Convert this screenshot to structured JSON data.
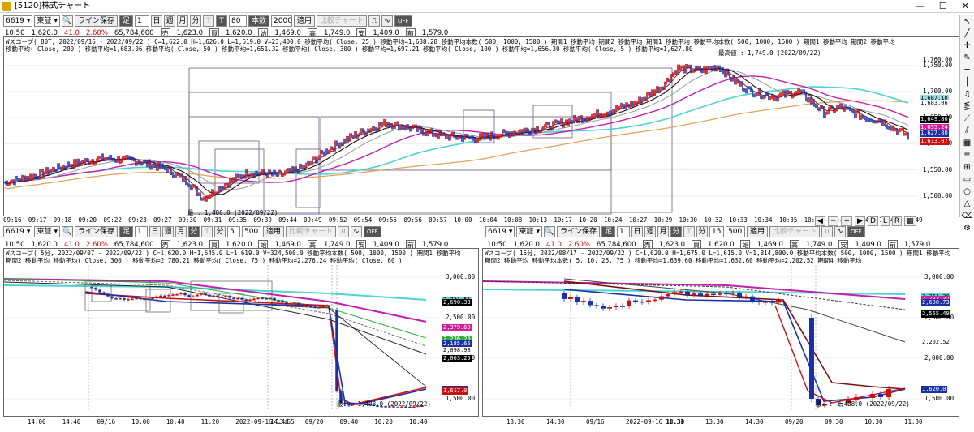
{
  "window": {
    "title": "[5120]株式チャート",
    "controls": [
      "—",
      "☐",
      "✕"
    ]
  },
  "toolbar_top": {
    "code": "6619",
    "market": "東証",
    "line_save": "ライン保存",
    "ashi": "足",
    "ashi_num": "1",
    "day": "日",
    "week": "週",
    "month": "月",
    "minute": "分",
    "t1": "T",
    "t2": "T",
    "bars_value": "80",
    "honsu": "本数",
    "count": "2000",
    "apply": "適用",
    "compare": "比較チャート",
    "off": "OFF"
  },
  "toolbar_left": {
    "code": "6619",
    "market": "東証",
    "line_save": "ライン保存",
    "ashi": "足",
    "ashi_num": "1",
    "day": "日",
    "week": "週",
    "month": "月",
    "minute": "分",
    "t1": "T",
    "minute2": "分",
    "value": "5",
    "count": "500",
    "apply": "適用",
    "compare": "比較チャート",
    "off": "OFF"
  },
  "toolbar_right": {
    "code": "6619",
    "market": "東証",
    "line_save": "ライン保存",
    "ashi": "足",
    "ashi_num": "1",
    "day": "日",
    "week": "週",
    "month": "月",
    "minute": "分",
    "t1": "T",
    "minute2": "分",
    "value": "15",
    "count": "500",
    "apply": "適用",
    "compare": "比較チャート",
    "off": "OFF"
  },
  "quote": {
    "time": "10:50",
    "price": "1,620.0",
    "change": "41.0",
    "pct": "2.60%",
    "volume": "65,784,600",
    "sell_lab": "売",
    "sell": "1,623.0",
    "buy_lab": "買",
    "buy": "1,620.0",
    "start_lab": "始",
    "open": "1,469.0",
    "high_lab": "高",
    "high": "1,749.0",
    "low_lab": "安",
    "prev": "1,409.0",
    "prev_lab": "前",
    "last": "1,579.0"
  },
  "top_chart": {
    "header1": "Wスコープ( 80T, 2022/09/16 - 2022/09/22 ) C=1,622.0 H=1,626.0 L=1,619.0 V=23,400.0   移動平均( Close, 25 ) 移動平均=1,638.28  移動平均本数( 500, 1000, 1500 ) 期間1 移動平均 期間2 移動平均 期間1 移動平均 移動平均本数( 500, 1000, 1500 ) 期間1 移動平均 期間2 移動平均",
    "header2": "移動平均( Close, 200 ) 移動平均=1,683.06   移動平均( Close, 50 ) 移動平均=1,651.32   移動平均( Close, 300 ) 移動平均=1,697.21   移動平均( Close, 100 ) 移動平均=1,656.30   移動平均( Close, 5 ) 移動平均=1,627.80",
    "max_label": "最高値 : 1,749.0 (2022/09/22)",
    "min_label": "最 : 1,480.0 (2022/09/22)",
    "y_ticks": [
      "1,760.00",
      "1,750.00",
      "1,700.00",
      "1,650.00",
      "1,600.00",
      "1,550.00",
      "1,500.00"
    ],
    "price_labels": [
      {
        "text": "1,687.10",
        "bg": "#9ad8e0",
        "fg": "#000"
      },
      {
        "text": "1,683.06",
        "bg": "#ffffff",
        "fg": "#000"
      },
      {
        "text": "1,649.80",
        "bg": "#000000",
        "fg": "#fff"
      },
      {
        "text": "1,635.24",
        "bg": "#d01f9a",
        "fg": "#fff"
      },
      {
        "text": "1,627.80",
        "bg": "#1b2fa6",
        "fg": "#fff"
      },
      {
        "text": "1,613.07",
        "bg": "#cc1010",
        "fg": "#fff"
      }
    ],
    "x_ticks": [
      "09:16",
      "09:17",
      "09:18",
      "09:20",
      "09:22",
      "09:23",
      "09:27",
      "09:30",
      "09:31",
      "09:35",
      "09:39",
      "09:44",
      "09:49",
      "09:52",
      "09:54",
      "09:55",
      "09:56",
      "09:57",
      "10:00",
      "10:04",
      "10:08",
      "10:13",
      "10:17",
      "10:20",
      "10:24",
      "10:27",
      "10:29",
      "10:30",
      "10:32",
      "10:33",
      "10:34",
      "10:35",
      "10:38",
      "10:41",
      "10:42",
      "10:44",
      "10:49"
    ]
  },
  "left_chart": {
    "header1": "Wスコープ( 5分, 2022/09/07 - 2022/09/22 ) C=1,620.0 H=1,645.0 L=1,619.0 V=324,500.0  移動平均本数( 500, 1000, 1500 ) 期間1 移動平均",
    "header2": "期間2 移動平均 移動平均( Close, 300 ) 移動平均=2,780.21  移動平均( Close, 75 ) 移動平均=2,276.24   移動平均( Close, 60 )",
    "y_ticks": [
      "3,000.00",
      "2,500.00",
      "2,000.00",
      "1,500.00"
    ],
    "min_label": "最↓ : 1,408.0 (2022/09/22)",
    "price_labels": [
      {
        "text": "2,721.51",
        "bg": "#5fd0d6",
        "fg": "#000"
      },
      {
        "text": "2,690.33",
        "bg": "#000000",
        "fg": "#fff"
      },
      {
        "text": "2,379.69",
        "bg": "#d01f9a",
        "fg": "#fff"
      },
      {
        "text": "2,236.20",
        "bg": "#2fae3d",
        "fg": "#fff"
      },
      {
        "text": "2,185.65",
        "bg": "#1b2fa6",
        "fg": "#fff"
      },
      {
        "text": "2,098.98",
        "bg": "#ffffff",
        "fg": "#000"
      },
      {
        "text": "2,003.25",
        "bg": "#000000",
        "fg": "#fff"
      },
      {
        "text": "1,617.0",
        "bg": "#1b2fa6",
        "fg": "#fff"
      },
      {
        "text": "1,617.0",
        "bg": "#cc1010",
        "fg": "#fff"
      }
    ],
    "x_ticks": [
      "14:00",
      "14:40",
      "09/16",
      "10:00",
      "10:40",
      "11:20",
      "2022-09-16 13:55",
      "14:40",
      "09/20",
      "09:40",
      "10:20",
      "10:40"
    ]
  },
  "right_chart": {
    "header1": "Wスコープ( 15分, 2022/08/17 - 2022/09/22 ) C=1,620.0 H=1,675.0 L=1,615.0 V=1,814,800.0  移動平均本数( 500, 1000, 1500 ) 期間1 移動平均",
    "header2": "期間2 移動平均 移動平均本数( 5, 10, 25, 75 ) 移動平均=1,639.60 移動平均=1,632.60 移動平均=2,202.52 期間4 移動平均",
    "y_ticks": [
      "3,000.00",
      "2,500.00",
      "2,000.00",
      "1,500.00"
    ],
    "min_label": "最↓ : 1,408.0 (2022/09/22)",
    "price_labels": [
      {
        "text": "2,764.20",
        "bg": "#5fd0d6",
        "fg": "#000"
      },
      {
        "text": "2,732.37",
        "bg": "#d01f9a",
        "fg": "#fff"
      },
      {
        "text": "2,690.73",
        "bg": "#1b2fa6",
        "fg": "#fff"
      },
      {
        "text": "2,555.49",
        "bg": "#000000",
        "fg": "#fff"
      },
      {
        "text": "2,202.52",
        "bg": "#ffffff",
        "fg": "#000"
      },
      {
        "text": "1,620.0",
        "bg": "#1b2fa6",
        "fg": "#fff"
      }
    ],
    "x_ticks": [
      "13:30",
      "14:30",
      "09/16",
      "2022-09-16 10:30",
      "11:31",
      "13:30",
      "14:30",
      "09/20",
      "09:30",
      "10:30",
      "11:30"
    ]
  },
  "colors": {
    "candle_up": "#cc1010",
    "candle_down": "#1b2fa6",
    "ma_cyan": "#4fd2d2",
    "ma_magenta": "#c020b0",
    "ma_orange": "#e0a050",
    "ma_black": "#111111",
    "ma_darkred": "#7a1010",
    "ma_gray": "#999999"
  }
}
